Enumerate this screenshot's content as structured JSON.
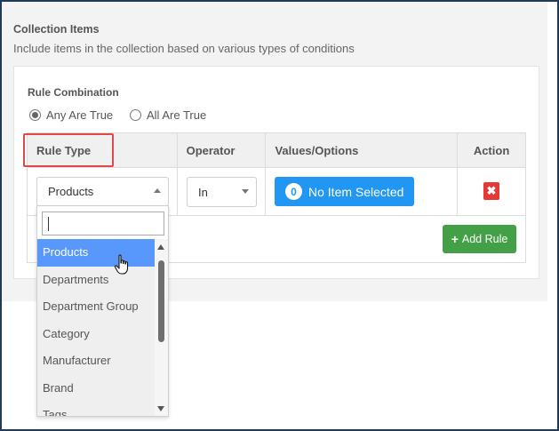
{
  "section": {
    "title": "Collection Items",
    "description": "Include items in the collection based on various types of conditions"
  },
  "rule_combination": {
    "label": "Rule Combination",
    "options": [
      {
        "label": "Any Are True",
        "checked": true
      },
      {
        "label": "All Are True",
        "checked": false
      }
    ]
  },
  "table": {
    "headers": [
      "Rule Type",
      "Operator",
      "Values/Options",
      "Action"
    ]
  },
  "rule_row": {
    "rule_type": "Products",
    "operator": "In",
    "values_count": "0",
    "values_label": "No Item Selected"
  },
  "add_rule_label": "Add Rule",
  "dropdown": {
    "search_value": "",
    "items": [
      "Products",
      "Departments",
      "Department Group",
      "Category",
      "Manufacturer",
      "Brand",
      "Tags"
    ],
    "active_index": 0
  },
  "colors": {
    "primary_blue": "#2196f3",
    "success_green": "#43a047",
    "danger_red": "#e53935",
    "highlight_red": "#e0494b",
    "active_option": "#5897fb"
  }
}
